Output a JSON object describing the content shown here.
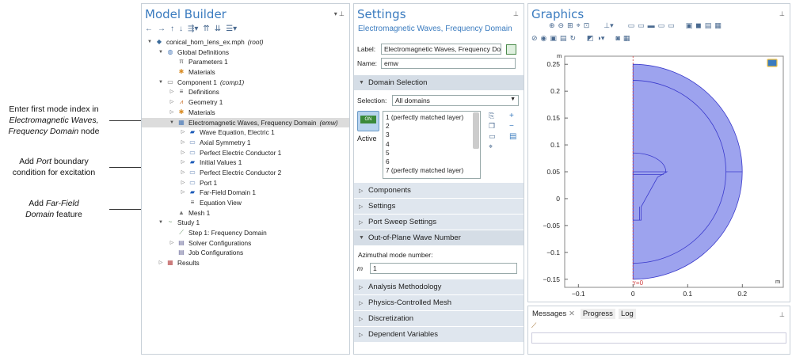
{
  "annotations": {
    "a1_l1": "Enter first mode index in",
    "a1_l2": "Electromagnetic Waves,",
    "a1_l3": "Frequency Domain",
    "a1_l3b": " node",
    "a2_l1a": "Add ",
    "a2_l1b": "Port",
    "a2_l1c": " boundary",
    "a2_l2": "condition for excitation",
    "a3_l1a": "Add ",
    "a3_l1b": "Far-Field",
    "a3_l2a": "Domain",
    "a3_l2b": " feature"
  },
  "model_builder": {
    "title": "Model Builder",
    "tree": [
      {
        "label": "conical_horn_lens_ex.mph",
        "tag": "(root)",
        "icon": "model-icon"
      },
      {
        "label": "Global Definitions",
        "icon": "globe-icon"
      },
      {
        "label": "Parameters 1",
        "icon": "parameters-icon"
      },
      {
        "label": "Materials",
        "icon": "materials-icon"
      },
      {
        "label": "Component 1",
        "tag": "(comp1)",
        "icon": "component-icon"
      },
      {
        "label": "Definitions",
        "icon": "definitions-icon"
      },
      {
        "label": "Geometry 1",
        "icon": "geometry-icon"
      },
      {
        "label": "Materials",
        "icon": "materials-icon"
      },
      {
        "label": "Electromagnetic Waves, Frequency Domain",
        "tag": "(emw)",
        "icon": "physics-icon"
      },
      {
        "label": "Wave Equation, Electric 1",
        "icon": "domain-feature-icon"
      },
      {
        "label": "Axial Symmetry 1",
        "icon": "boundary-feature-icon"
      },
      {
        "label": "Perfect Electric Conductor 1",
        "icon": "boundary-feature-icon"
      },
      {
        "label": "Initial Values 1",
        "icon": "domain-feature-icon"
      },
      {
        "label": "Perfect Electric Conductor 2",
        "icon": "boundary-feature-icon"
      },
      {
        "label": "Port 1",
        "icon": "boundary-feature-icon"
      },
      {
        "label": "Far-Field Domain 1",
        "icon": "domain-feature-icon"
      },
      {
        "label": "Equation View",
        "icon": "equation-icon"
      },
      {
        "label": "Mesh 1",
        "icon": "mesh-icon"
      },
      {
        "label": "Study 1",
        "icon": "study-icon"
      },
      {
        "label": "Step 1: Frequency Domain",
        "icon": "step-icon"
      },
      {
        "label": "Solver Configurations",
        "icon": "solver-icon"
      },
      {
        "label": "Job Configurations",
        "icon": "job-icon"
      },
      {
        "label": "Results",
        "icon": "results-icon"
      }
    ]
  },
  "settings": {
    "title": "Settings",
    "subtitle": "Electromagnetic Waves, Frequency Domain",
    "label_caption": "Label:",
    "label_value": "Electromagnetic Waves, Frequency Dom",
    "name_caption": "Name:",
    "name_value": "emw",
    "domain_selection": "Domain Selection",
    "selection_caption": "Selection:",
    "selection_value": "All domains",
    "domains": [
      "1 (perfectly matched layer)",
      "2",
      "3",
      "4",
      "5",
      "6",
      "7 (perfectly matched layer)"
    ],
    "active_label": "Active",
    "toggle_text": "ON",
    "components": "Components",
    "settings_sec": "Settings",
    "port_sweep": "Port Sweep Settings",
    "out_of_plane": "Out-of-Plane Wave Number",
    "azimuthal_caption": "Azimuthal mode number:",
    "m_symbol": "m",
    "m_value": "1",
    "analysis": "Analysis Methodology",
    "physics_mesh": "Physics-Controlled Mesh",
    "discretization": "Discretization",
    "dependent": "Dependent Variables"
  },
  "graphics": {
    "title": "Graphics",
    "axis_unit_y": "m",
    "axis_unit_x": "m",
    "y_ticks": [
      "0.25",
      "0.2",
      "0.15",
      "0.1",
      "0.05",
      "0",
      "−0.05",
      "−0.1",
      "−0.15"
    ],
    "x_ticks": [
      "−0.1",
      "0",
      "0.1",
      "0.2"
    ],
    "r0_label": "r=0",
    "geometry_color": "#9da3ee"
  },
  "messages": {
    "tab1": "Messages",
    "tab2": "Progress",
    "tab3": "Log"
  }
}
